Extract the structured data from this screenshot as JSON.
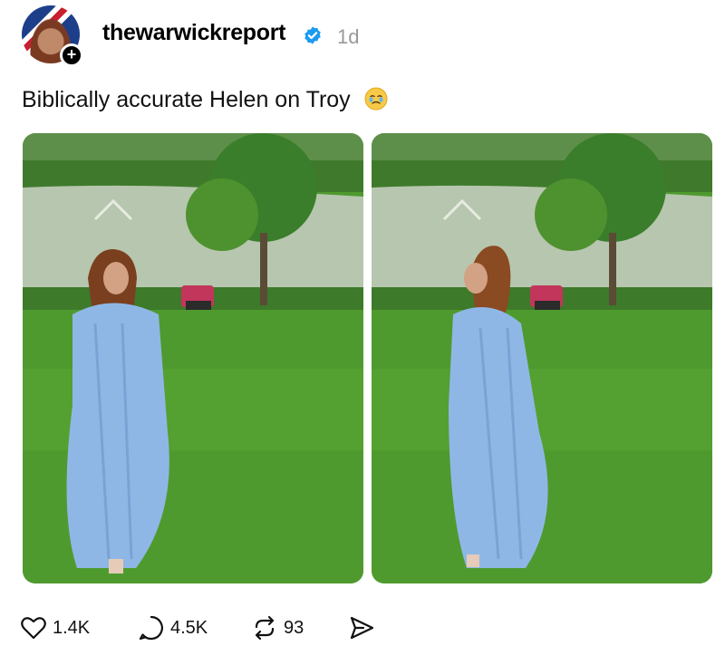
{
  "post": {
    "username": "thewarwickreport",
    "timestamp": "1d",
    "caption": "Biblically accurate Helen on Troy",
    "caption_emoji": "face-holding-back-tears-emoji"
  },
  "images": [
    {
      "name": "photo-left"
    },
    {
      "name": "photo-right"
    }
  ],
  "actions": {
    "likes": "1.4K",
    "comments": "4.5K",
    "reposts": "93"
  },
  "colors": {
    "verified_badge": "#1d9bf0",
    "timestamp_text": "#999999",
    "grass": "#4f9a2e",
    "pond": "#b7c6ae",
    "dress": "#8fb7e6"
  },
  "icons": [
    "heart-icon",
    "comment-icon",
    "repost-icon",
    "share-icon",
    "verified-icon",
    "plus-icon"
  ]
}
